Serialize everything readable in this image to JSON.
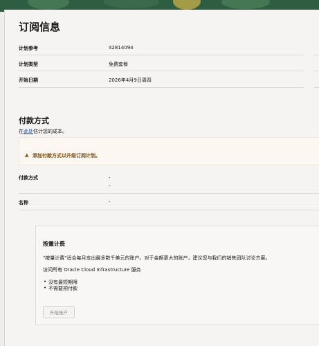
{
  "subscription": {
    "title": "订阅信息",
    "rows": [
      {
        "label": "计划参考",
        "value": "42814094"
      },
      {
        "label": "计划类型",
        "value": "免费套餐"
      },
      {
        "label": "开始日期",
        "value": "2026年4月9日周四"
      }
    ]
  },
  "payment": {
    "title": "付款方式",
    "desc_prefix": "在",
    "desc_link": "此处",
    "desc_suffix": "估计您的成本。",
    "warning_icon": "warning-triangle-icon",
    "warning_text": "添加付款方式以升级订阅计划。",
    "method_label": "付款方式",
    "method_values": [
      "-",
      "-"
    ],
    "name_label": "名称",
    "name_value": "-"
  },
  "payg": {
    "title": "按量计费",
    "line1": "\"按量计费\"适合每月支出最多数千美元的账户。对于金额更大的账户，建议您与我们的销售团队讨论方案。",
    "line2": "访问所有 Oracle Cloud Infrastructure 服务",
    "bullets": [
      "没有最短期限",
      "不需要预付款"
    ],
    "button": "升级账户"
  }
}
